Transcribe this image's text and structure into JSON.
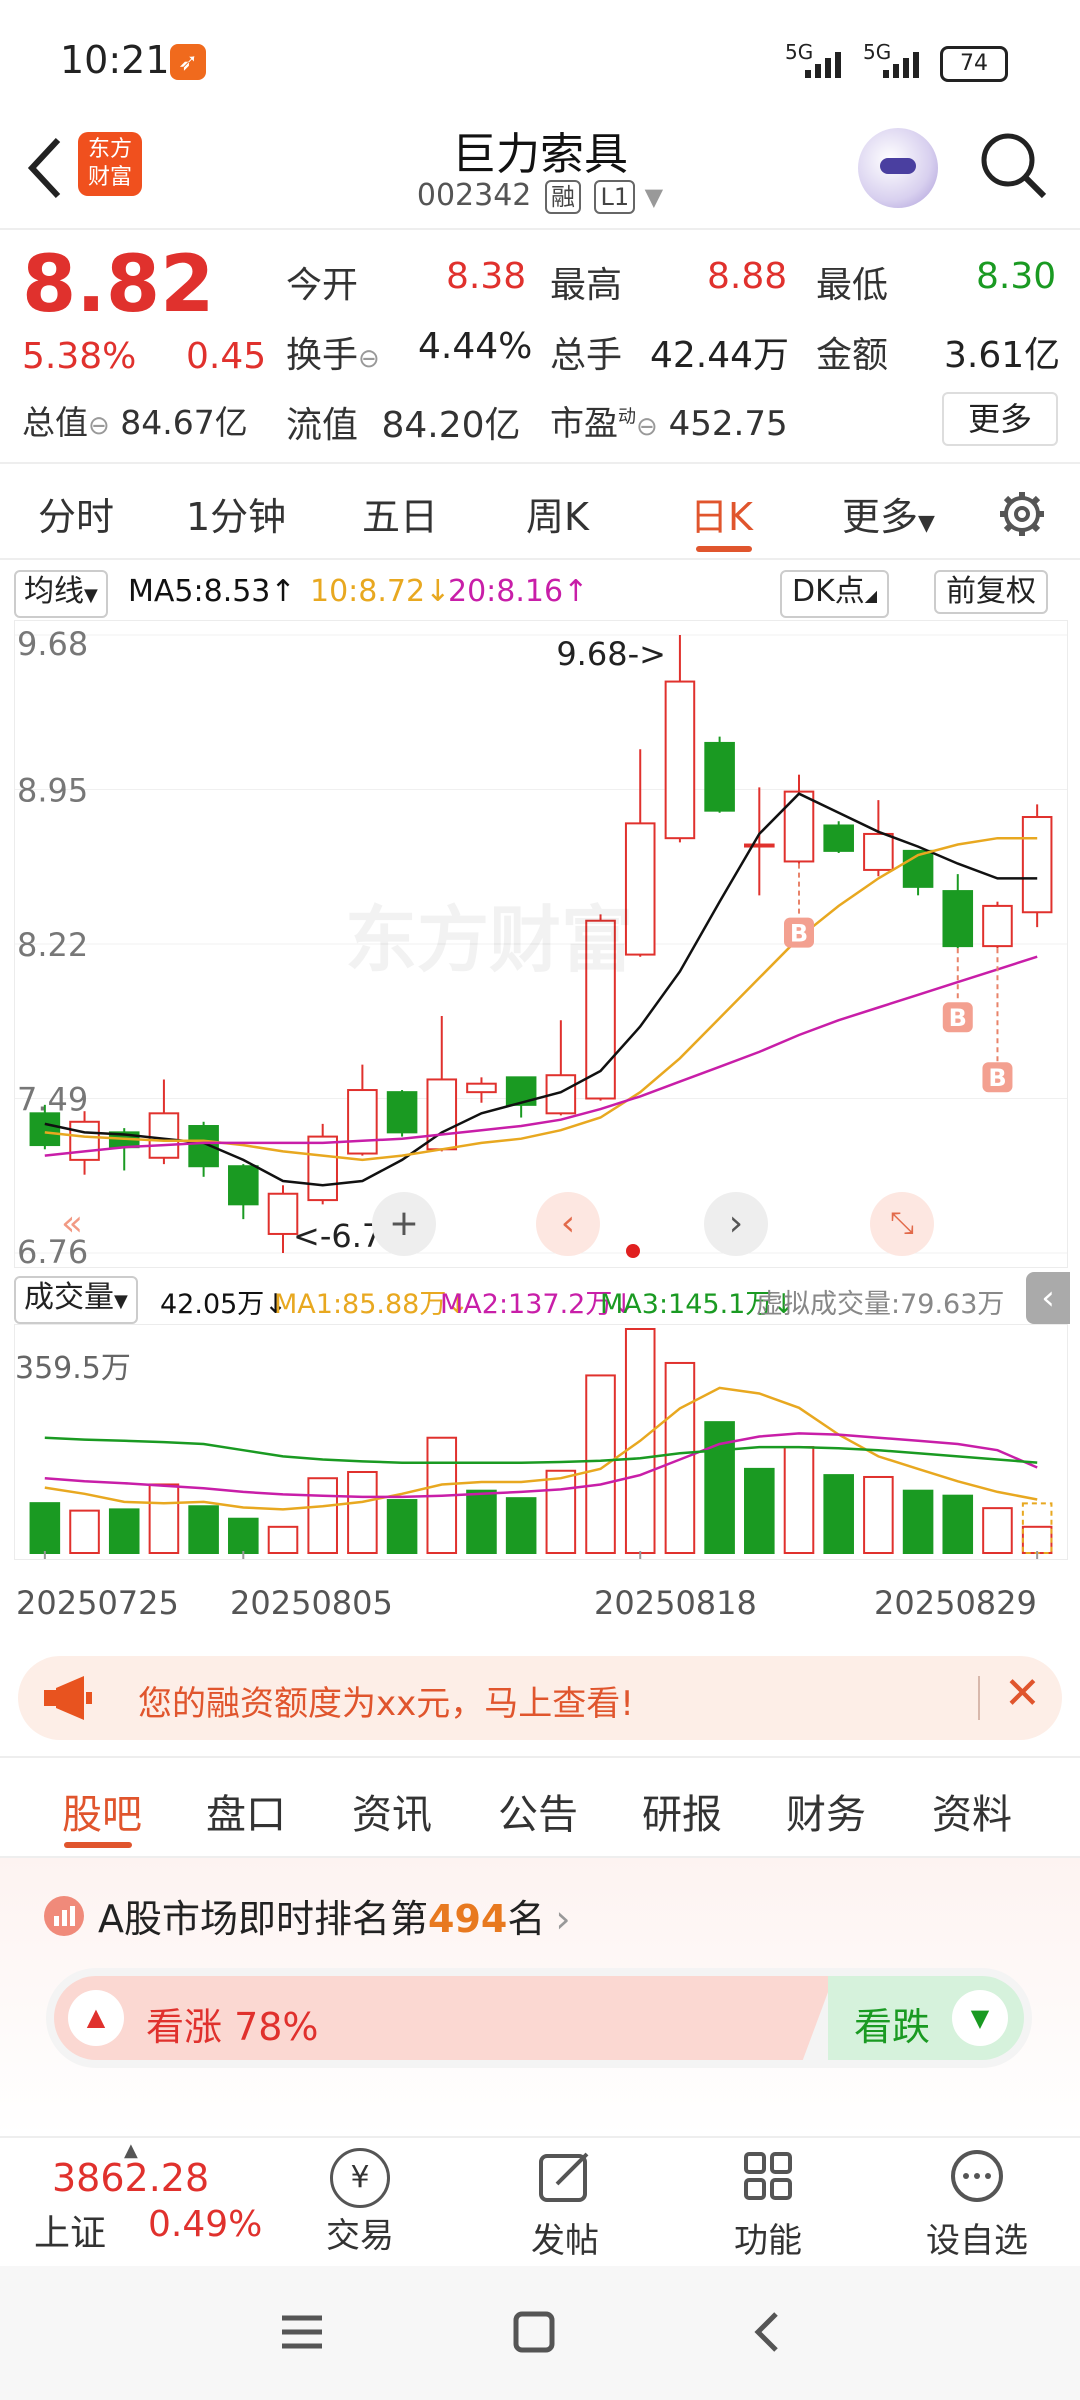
{
  "status": {
    "time": "10:21",
    "signal1": "5G",
    "signal2": "5G",
    "battery": "74"
  },
  "header": {
    "back_icon": "back-arrow-icon",
    "logo_line1": "东方",
    "logo_line2": "财富",
    "title": "巨力索具",
    "code": "002342",
    "badge1": "融",
    "badge2": "L1"
  },
  "quote": {
    "price": "8.82",
    "pct": "5.38%",
    "chg": "0.45",
    "open_label": "今开",
    "open": "8.38",
    "high_label": "最高",
    "high": "8.88",
    "low_label": "最低",
    "low": "8.30",
    "turnover_label": "换手",
    "turnover": "4.44%",
    "volume_label": "总手",
    "volume": "42.44万",
    "amount_label": "金额",
    "amount": "3.61亿",
    "mktcap_label": "总值",
    "mktcap": "84.67亿",
    "float_label": "流值",
    "float": "84.20亿",
    "pe_label": "市盈",
    "pe_sup": "动",
    "pe": "452.75",
    "more_button": "更多"
  },
  "tabs": {
    "items": [
      "分时",
      "1分钟",
      "五日",
      "周K",
      "日K",
      "更多"
    ],
    "active": 4
  },
  "chart_bar": {
    "ma_select": "均线",
    "ma5": "MA5:8.53",
    "ma10": "10:8.72",
    "ma20": "20:8.16",
    "dk_button": "DK点",
    "adj_button": "前复权"
  },
  "chart_labels": {
    "max_marker": "9.68->",
    "min_marker": "<-6.76",
    "b_marker": "B",
    "watermark": "东方财富"
  },
  "volume_bar": {
    "select": "成交量",
    "vol": "42.05万",
    "ma1": "MA1:85.88万",
    "ma2": "MA2:137.2万",
    "ma3": "MA3:145.1万",
    "virtual": "虚拟成交量:79.63万",
    "y_top": "359.5万"
  },
  "dates": [
    "20250725",
    "20250805",
    "20250818",
    "20250829"
  ],
  "promo": {
    "text": "您的融资额度为xx元，马上查看!"
  },
  "section_tabs": {
    "items": [
      "股吧",
      "盘口",
      "资讯",
      "公告",
      "研报",
      "财务",
      "资料"
    ],
    "active": 0
  },
  "ranking": {
    "prefix": "A股市场即时排名第",
    "rank": "494",
    "suffix": "名"
  },
  "sentiment": {
    "up_label": "看涨 78%",
    "down_label": "看跌"
  },
  "bottom": {
    "index_value": "3862.28",
    "index_name": "上证",
    "index_pct": "0.49%",
    "trade": "交易",
    "post": "发帖",
    "func": "功能",
    "watch": "设自选"
  },
  "colors": {
    "up": "#e0312d",
    "down": "#1a9a22",
    "ma5": "#111111",
    "ma10": "#e8a820",
    "ma20": "#c81ea8",
    "accent": "#e0552d"
  },
  "chart_data": {
    "type": "candlestick",
    "y_ticks": [
      9.68,
      8.95,
      8.22,
      7.49,
      6.76
    ],
    "ylim": [
      6.76,
      9.68
    ],
    "dates": [
      "20250725",
      "20250805",
      "20250818",
      "20250829"
    ],
    "candles": [
      {
        "o": 7.42,
        "c": 7.27,
        "h": 7.46,
        "l": 7.25
      },
      {
        "o": 7.2,
        "c": 7.38,
        "h": 7.43,
        "l": 7.13
      },
      {
        "o": 7.33,
        "c": 7.26,
        "h": 7.35,
        "l": 7.15
      },
      {
        "o": 7.21,
        "c": 7.42,
        "h": 7.58,
        "l": 7.18
      },
      {
        "o": 7.36,
        "c": 7.17,
        "h": 7.38,
        "l": 7.12
      },
      {
        "o": 7.17,
        "c": 6.99,
        "h": 7.18,
        "l": 6.92
      },
      {
        "o": 6.85,
        "c": 7.04,
        "h": 7.08,
        "l": 6.76
      },
      {
        "o": 7.01,
        "c": 7.31,
        "h": 7.37,
        "l": 6.99
      },
      {
        "o": 7.23,
        "c": 7.53,
        "h": 7.65,
        "l": 7.22
      },
      {
        "o": 7.52,
        "c": 7.33,
        "h": 7.53,
        "l": 7.31
      },
      {
        "o": 7.25,
        "c": 7.58,
        "h": 7.88,
        "l": 7.24
      },
      {
        "o": 7.52,
        "c": 7.56,
        "h": 7.59,
        "l": 7.47
      },
      {
        "o": 7.59,
        "c": 7.46,
        "h": 7.59,
        "l": 7.4
      },
      {
        "o": 7.42,
        "c": 7.6,
        "h": 7.86,
        "l": 7.41
      },
      {
        "o": 7.49,
        "c": 8.33,
        "h": 8.36,
        "l": 7.48
      },
      {
        "o": 8.17,
        "c": 8.79,
        "h": 9.14,
        "l": 8.16
      },
      {
        "o": 8.72,
        "c": 9.46,
        "h": 9.68,
        "l": 8.7
      },
      {
        "o": 9.17,
        "c": 8.85,
        "h": 9.2,
        "l": 8.84
      },
      {
        "o": 8.69,
        "c": 8.69,
        "h": 8.96,
        "l": 8.45
      },
      {
        "o": 8.61,
        "c": 8.94,
        "h": 9.02,
        "l": 8.6
      },
      {
        "o": 8.78,
        "c": 8.66,
        "h": 8.8,
        "l": 8.65
      },
      {
        "o": 8.57,
        "c": 8.74,
        "h": 8.9,
        "l": 8.54
      },
      {
        "o": 8.66,
        "c": 8.49,
        "h": 8.66,
        "l": 8.45
      },
      {
        "o": 8.47,
        "c": 8.21,
        "h": 8.55,
        "l": 8.2
      },
      {
        "o": 8.21,
        "c": 8.4,
        "h": 8.42,
        "l": 8.2
      },
      {
        "o": 8.37,
        "c": 8.82,
        "h": 8.88,
        "l": 8.3
      }
    ],
    "ma5": [
      7.37,
      7.33,
      7.32,
      7.3,
      7.28,
      7.2,
      7.1,
      7.08,
      7.1,
      7.2,
      7.33,
      7.42,
      7.47,
      7.52,
      7.62,
      7.83,
      8.09,
      8.42,
      8.74,
      8.93,
      8.84,
      8.75,
      8.68,
      8.6,
      8.53,
      8.53
    ],
    "ma10": [
      7.33,
      7.31,
      7.3,
      7.29,
      7.29,
      7.27,
      7.24,
      7.22,
      7.2,
      7.22,
      7.25,
      7.28,
      7.3,
      7.34,
      7.4,
      7.52,
      7.68,
      7.87,
      8.06,
      8.25,
      8.4,
      8.53,
      8.64,
      8.69,
      8.72,
      8.72
    ],
    "ma20": [
      7.22,
      7.24,
      7.26,
      7.27,
      7.28,
      7.28,
      7.28,
      7.28,
      7.29,
      7.3,
      7.32,
      7.34,
      7.36,
      7.39,
      7.44,
      7.5,
      7.57,
      7.64,
      7.71,
      7.79,
      7.86,
      7.92,
      7.98,
      8.04,
      8.1,
      8.16
    ],
    "b_points": [
      19,
      23,
      24
    ],
    "volume": {
      "ylim": [
        0,
        359.5
      ],
      "values": [
        80,
        68,
        70,
        110,
        75,
        55,
        42,
        120,
        130,
        85,
        185,
        100,
        88,
        132,
        285,
        359.5,
        305,
        210,
        135,
        170,
        125,
        122,
        100,
        92,
        72,
        42.05
      ],
      "up": [
        false,
        true,
        false,
        true,
        false,
        false,
        true,
        true,
        true,
        false,
        true,
        false,
        false,
        true,
        true,
        true,
        true,
        false,
        false,
        true,
        false,
        true,
        false,
        false,
        true,
        true
      ],
      "ma1": [
        105,
        95,
        82,
        80,
        82,
        73,
        70,
        75,
        82,
        95,
        110,
        114,
        114,
        120,
        135,
        180,
        232,
        265,
        256,
        233,
        190,
        155,
        135,
        115,
        98,
        85.88
      ],
      "ma2": [
        120,
        115,
        112,
        108,
        104,
        98,
        94,
        92,
        90,
        90,
        92,
        95,
        98,
        102,
        110,
        125,
        150,
        175,
        187,
        192,
        190,
        185,
        180,
        175,
        165,
        137.2
      ],
      "ma3": [
        185,
        182,
        180,
        178,
        175,
        165,
        155,
        150,
        147,
        145,
        145,
        145,
        145,
        146,
        148,
        152,
        160,
        165,
        170,
        170,
        168,
        165,
        160,
        155,
        150,
        145.1
      ]
    }
  }
}
